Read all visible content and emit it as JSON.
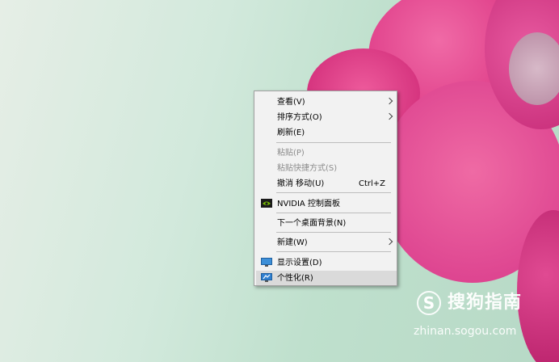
{
  "menu": {
    "items": [
      {
        "label": "查看(V)",
        "submenu": true
      },
      {
        "label": "排序方式(O)",
        "submenu": true
      },
      {
        "label": "刷新(E)"
      },
      {
        "label": "粘贴(P)",
        "disabled": true
      },
      {
        "label": "粘贴快捷方式(S)",
        "disabled": true
      },
      {
        "label": "撤消 移动(U)",
        "shortcut": "Ctrl+Z"
      },
      {
        "label": "NVIDIA 控制面板",
        "icon": "nvidia-icon"
      },
      {
        "label": "下一个桌面背景(N)"
      },
      {
        "label": "新建(W)",
        "submenu": true
      },
      {
        "label": "显示设置(D)",
        "icon": "display-settings-icon"
      },
      {
        "label": "个性化(R)",
        "icon": "personalize-icon",
        "highlighted": true
      }
    ]
  },
  "watermark": {
    "symbol": "S",
    "brand": "搜狗指南",
    "url": "zhinan.sogou.com"
  },
  "colors": {
    "flower": "#e0408f",
    "menu_bg": "#f2f2f2",
    "highlight": "#dadada",
    "nvidia_green": "#76b900"
  }
}
